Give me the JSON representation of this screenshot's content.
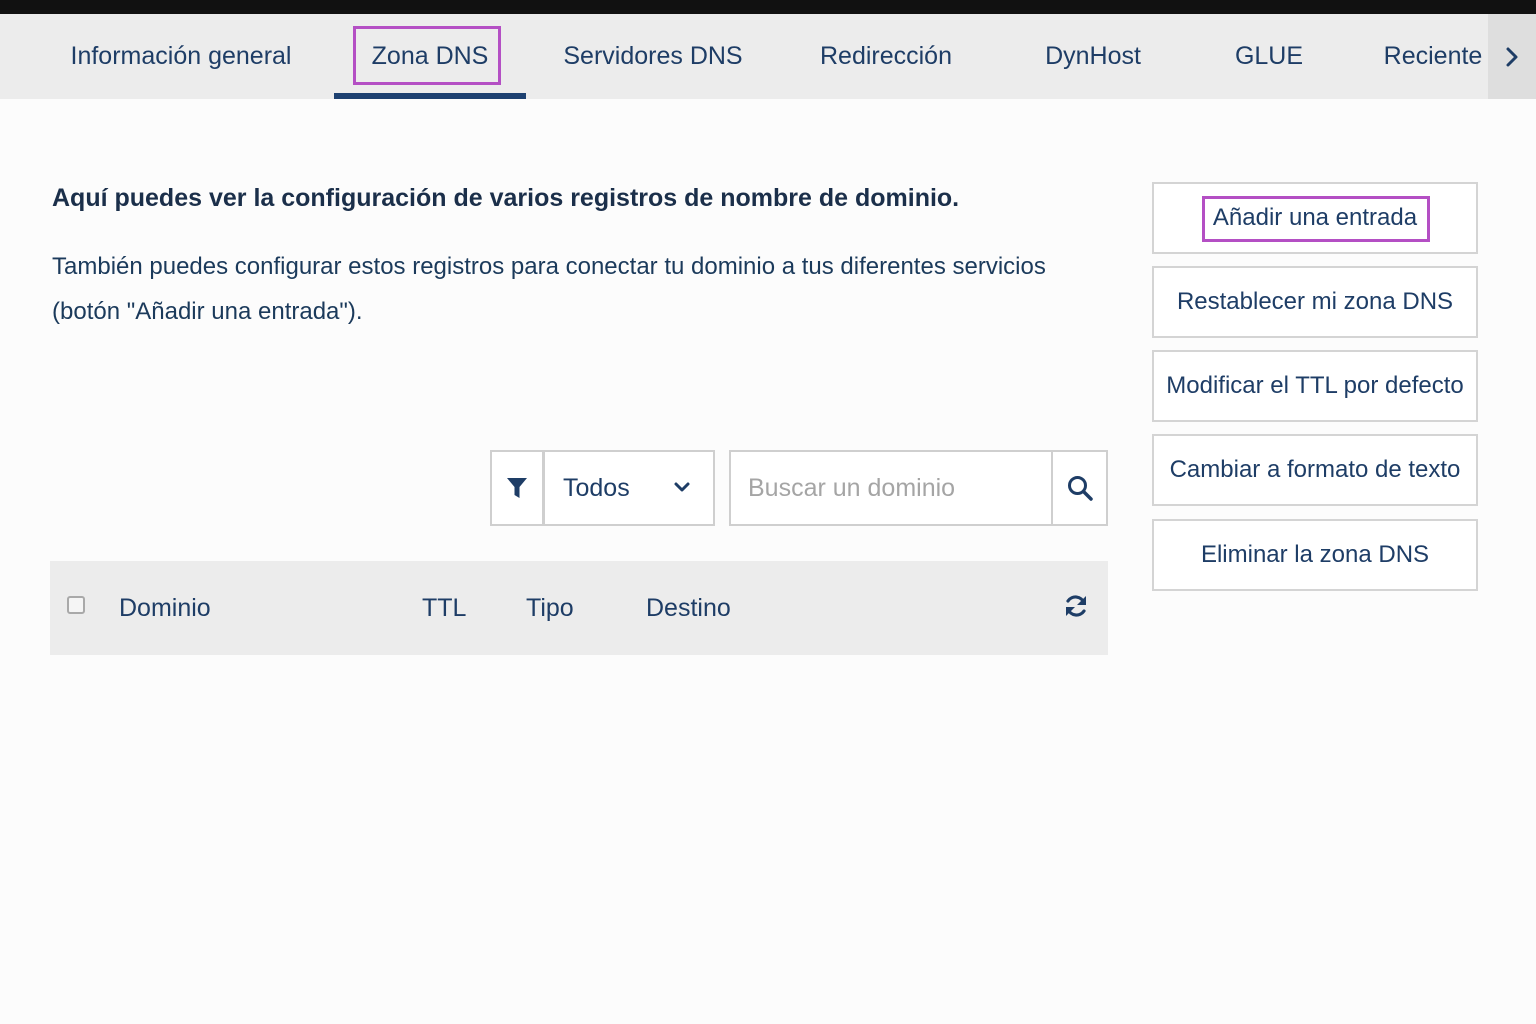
{
  "tabs": {
    "items": [
      {
        "label": "Información general",
        "active": false
      },
      {
        "label": "Zona DNS",
        "active": true
      },
      {
        "label": "Servidores DNS",
        "active": false
      },
      {
        "label": "Redirección",
        "active": false
      },
      {
        "label": "DynHost",
        "active": false
      },
      {
        "label": "GLUE",
        "active": false
      },
      {
        "label": "Reciente",
        "active": false
      }
    ],
    "next_icon": "chevron-right-icon"
  },
  "intro": {
    "title": "Aquí puedes ver la configuración de varios registros de nombre de dominio.",
    "text": "También puedes configurar estos registros para conectar tu dominio a tus diferentes servicios (botón \"Añadir una entrada\")."
  },
  "actions": [
    {
      "label": "Añadir una entrada"
    },
    {
      "label": "Restablecer mi zona DNS"
    },
    {
      "label": "Modificar el TTL por defecto"
    },
    {
      "label": "Cambiar a formato de texto"
    },
    {
      "label": "Eliminar la zona DNS"
    }
  ],
  "filter": {
    "icon": "filter-icon",
    "selected": "Todos"
  },
  "search": {
    "placeholder": "Buscar un dominio",
    "value": "",
    "icon": "search-icon"
  },
  "table": {
    "columns": [
      "Dominio",
      "TTL",
      "Tipo",
      "Destino"
    ],
    "refresh_icon": "refresh-icon"
  },
  "colors": {
    "primary": "#1e3d66",
    "highlight": "#b44fc4",
    "tab_bar": "#ececec",
    "active_underline": "#1d4070"
  }
}
